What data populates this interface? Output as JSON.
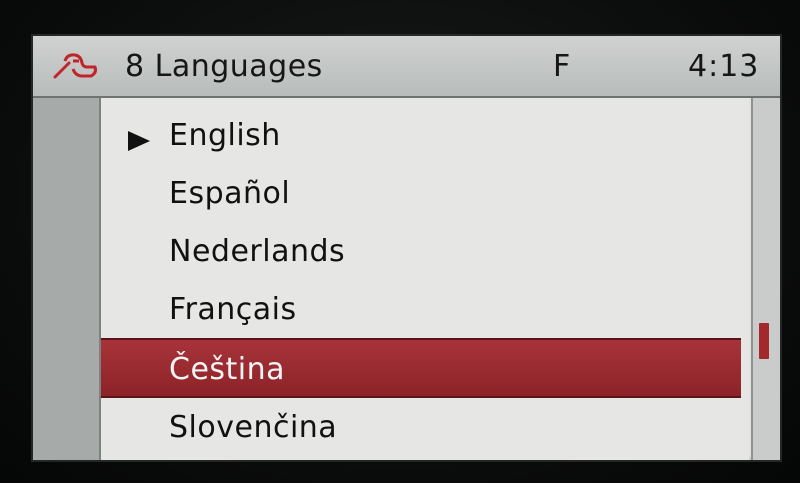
{
  "header": {
    "icon": "wrench-icon",
    "title": "8 Languages",
    "mode": "F",
    "time": "4:13"
  },
  "languages": {
    "items": [
      {
        "label": "English"
      },
      {
        "label": "Español"
      },
      {
        "label": "Nederlands"
      },
      {
        "label": "Français"
      },
      {
        "label": "Čeština"
      },
      {
        "label": "Slovenčina"
      }
    ],
    "active_index": 0,
    "highlighted_index": 4
  },
  "colors": {
    "accent": "#9a2a30",
    "header_bg": "#c4c7c5",
    "list_bg": "#e6e7e5"
  }
}
